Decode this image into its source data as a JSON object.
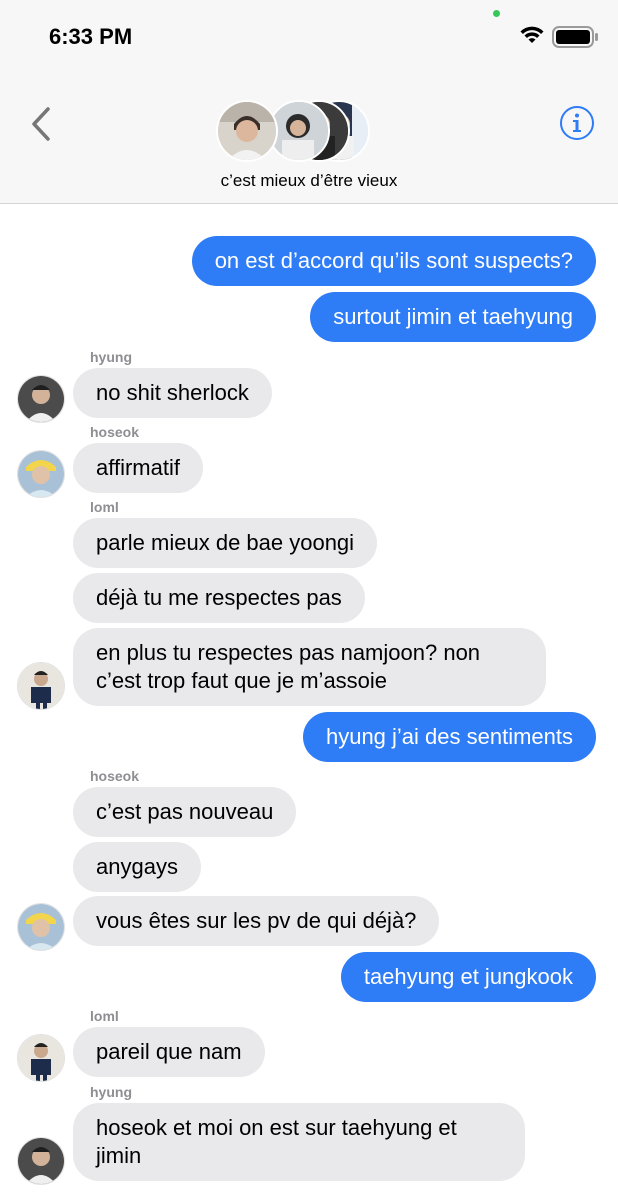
{
  "status_bar": {
    "time": "6:33 PM"
  },
  "header": {
    "group_name": "c’est mieux d’être vieux",
    "back_icon": "chevron-left-icon",
    "info_icon": "info-circle-icon",
    "accent_color": "#2e7cf6"
  },
  "messages": [
    {
      "id": 0,
      "direction": "out",
      "text": "on est d’accord qu’ils sont suspects?"
    },
    {
      "id": 1,
      "direction": "out",
      "text": "surtout jimin et taehyung"
    },
    {
      "id": 2,
      "direction": "in",
      "sender": "hyung",
      "text": "no shit sherlock",
      "avatar": true
    },
    {
      "id": 3,
      "direction": "in",
      "sender": "hoseok",
      "text": "affirmatif",
      "avatar": true
    },
    {
      "id": 4,
      "direction": "in",
      "sender": "loml",
      "text": "parle mieux de bae yoongi"
    },
    {
      "id": 5,
      "direction": "in",
      "text": "déjà tu me respectes pas"
    },
    {
      "id": 6,
      "direction": "in",
      "text": "en plus tu respectes pas namjoon? non c’est trop faut que je m’assoie",
      "avatar": true
    },
    {
      "id": 7,
      "direction": "out",
      "text": "hyung j’ai des sentiments"
    },
    {
      "id": 8,
      "direction": "in",
      "sender": "hoseok",
      "text": "c’est pas nouveau"
    },
    {
      "id": 9,
      "direction": "in",
      "text": "anygays"
    },
    {
      "id": 10,
      "direction": "in",
      "text": "vous êtes sur les pv de qui déjà?",
      "avatar": true
    },
    {
      "id": 11,
      "direction": "out",
      "text": "taehyung et jungkook"
    },
    {
      "id": 12,
      "direction": "in",
      "sender": "loml",
      "text": "pareil que nam",
      "avatar": true
    },
    {
      "id": 13,
      "direction": "in",
      "sender": "hyung",
      "text": "hoseok et moi on est sur taehyung et jimin",
      "avatar": true
    }
  ]
}
